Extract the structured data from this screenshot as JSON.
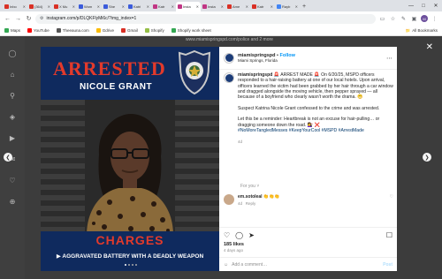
{
  "tabs": [
    {
      "label": "Inbo",
      "color": "#d93025",
      "active": false
    },
    {
      "label": "(364)",
      "color": "#d93025",
      "active": false
    },
    {
      "label": "X Mu",
      "color": "#d93025",
      "active": false
    },
    {
      "label": "Wom",
      "color": "#3b5bdb",
      "active": false
    },
    {
      "label": "She",
      "color": "#3b5bdb",
      "active": false
    },
    {
      "label": "Katri",
      "color": "#3b5bdb",
      "active": false
    },
    {
      "label": "Katr",
      "color": "#c13584",
      "active": false
    },
    {
      "label": "Insta",
      "color": "#c13584",
      "active": true
    },
    {
      "label": "Insta",
      "color": "#c13584",
      "active": false
    },
    {
      "label": "Ame",
      "color": "#d93025",
      "active": false
    },
    {
      "label": "Katr",
      "color": "#d93025",
      "active": false
    },
    {
      "label": "Rayb",
      "color": "#4285f4",
      "active": false
    }
  ],
  "url": "instagram.com/p/DLQKFlyMi6c/?img_index=1",
  "bookmarks": [
    {
      "label": "Maps",
      "color": "#34a853"
    },
    {
      "label": "YouTube",
      "color": "#ff0000"
    },
    {
      "label": "Theeauna.com",
      "color": "#555555"
    },
    {
      "label": "Gdrive",
      "color": "#fbbc04"
    },
    {
      "label": "Gmail",
      "color": "#d93025"
    },
    {
      "label": "Shopify",
      "color": "#95bf47"
    },
    {
      "label": "Shopify work sheet",
      "color": "#34a853"
    }
  ],
  "all_bookmarks": "All Bookmarks",
  "bg_caption": "www.miamispringspd.com/police and 2 more",
  "image": {
    "arrested": "ARRESTED",
    "name": "NICOLE GRANT",
    "charges": "CHARGES",
    "charge_detail": "▶ AGGRAVATED BATTERY WITH A DEADLY WEAPON"
  },
  "post": {
    "username": "miamispringspd",
    "follow": "Follow",
    "location": "Miami Springs, Florida",
    "caption_user": "miamispringspd",
    "caption_p1": "🚨 ARREST MADE 🚨 On 6/20/25, MSPD officers responded to a hair-raising battery at one of our local hotels. Upon arrival, officers learned the victim had been grabbed by her hair through a car window and dragged alongside the moving vehicle, then pepper sprayed — all because of a boyfriend who clearly wasn't worth the drama. 😬",
    "caption_p2": "Suspect Katrina Nicole Grant confessed to the crime and was arrested.",
    "caption_p3": "Let this be a reminder: Heartbreak is not an excuse for hair-pulling… or dragging someone down the road. 💇‍♀️ ❌",
    "hashtags": "#NoMoreTangledMesses #KeepYourCool #MSPD #ArrestMade",
    "caption_age": "4d",
    "for_you": "For you",
    "comment_user": "em.sotoleal",
    "comment_text": "👏👏👏",
    "comment_age": "4d",
    "comment_reply": "Reply",
    "likes": "185 likes",
    "posted": "4 days ago",
    "add_comment_placeholder": "Add a comment…",
    "post_button": "Post"
  }
}
